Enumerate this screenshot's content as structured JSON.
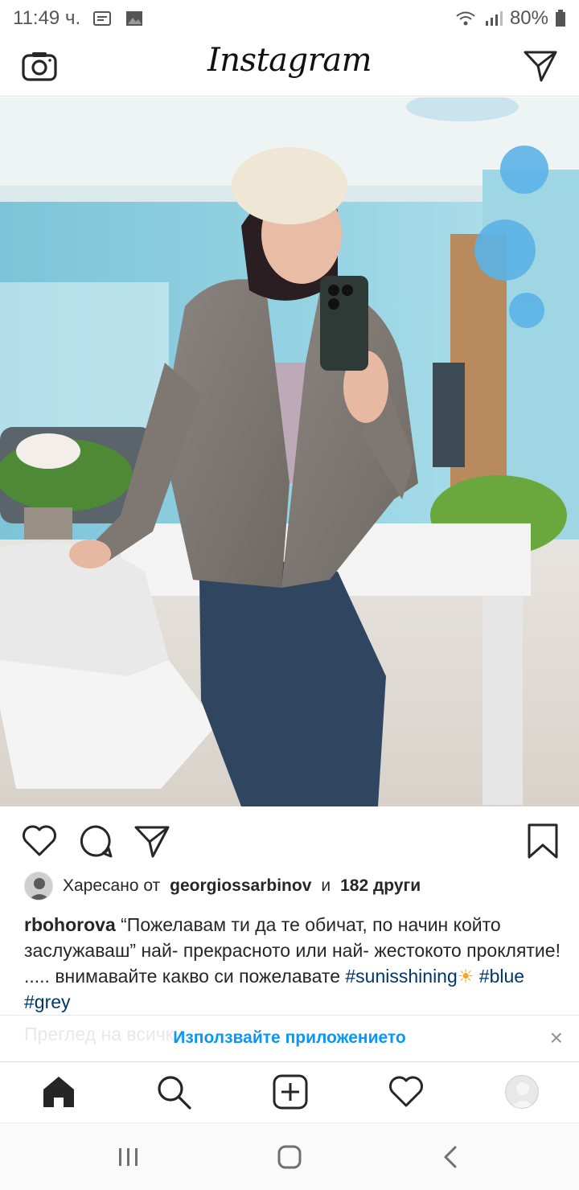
{
  "status_bar": {
    "time": "11:49 ч.",
    "battery": "80%"
  },
  "top_bar": {
    "logo": "Instagram"
  },
  "photo": {
    "alt_icon": "photo-icon"
  },
  "likes": {
    "prefix": "Харесано от",
    "user": "georgiossarbinov",
    "and": "и",
    "others": "182 други"
  },
  "caption": {
    "username": "rbohorova",
    "text": "“Пожелавам ти да те обичат, по начин който заслужаваш” най- прекрасното или най- жестокото проклятие! ..... внимавайте какво си пожелавате",
    "tag1": "#sunisshining",
    "emoji": "☀",
    "tag2": "#blue",
    "tag3": "#grey"
  },
  "app_banner": {
    "ghost_text": "Преглед на всички",
    "cta": "Използвайте приложението",
    "close": "×"
  },
  "colors": {
    "accent": "#0095f6",
    "hashtag": "#00376b",
    "text": "#262626"
  }
}
